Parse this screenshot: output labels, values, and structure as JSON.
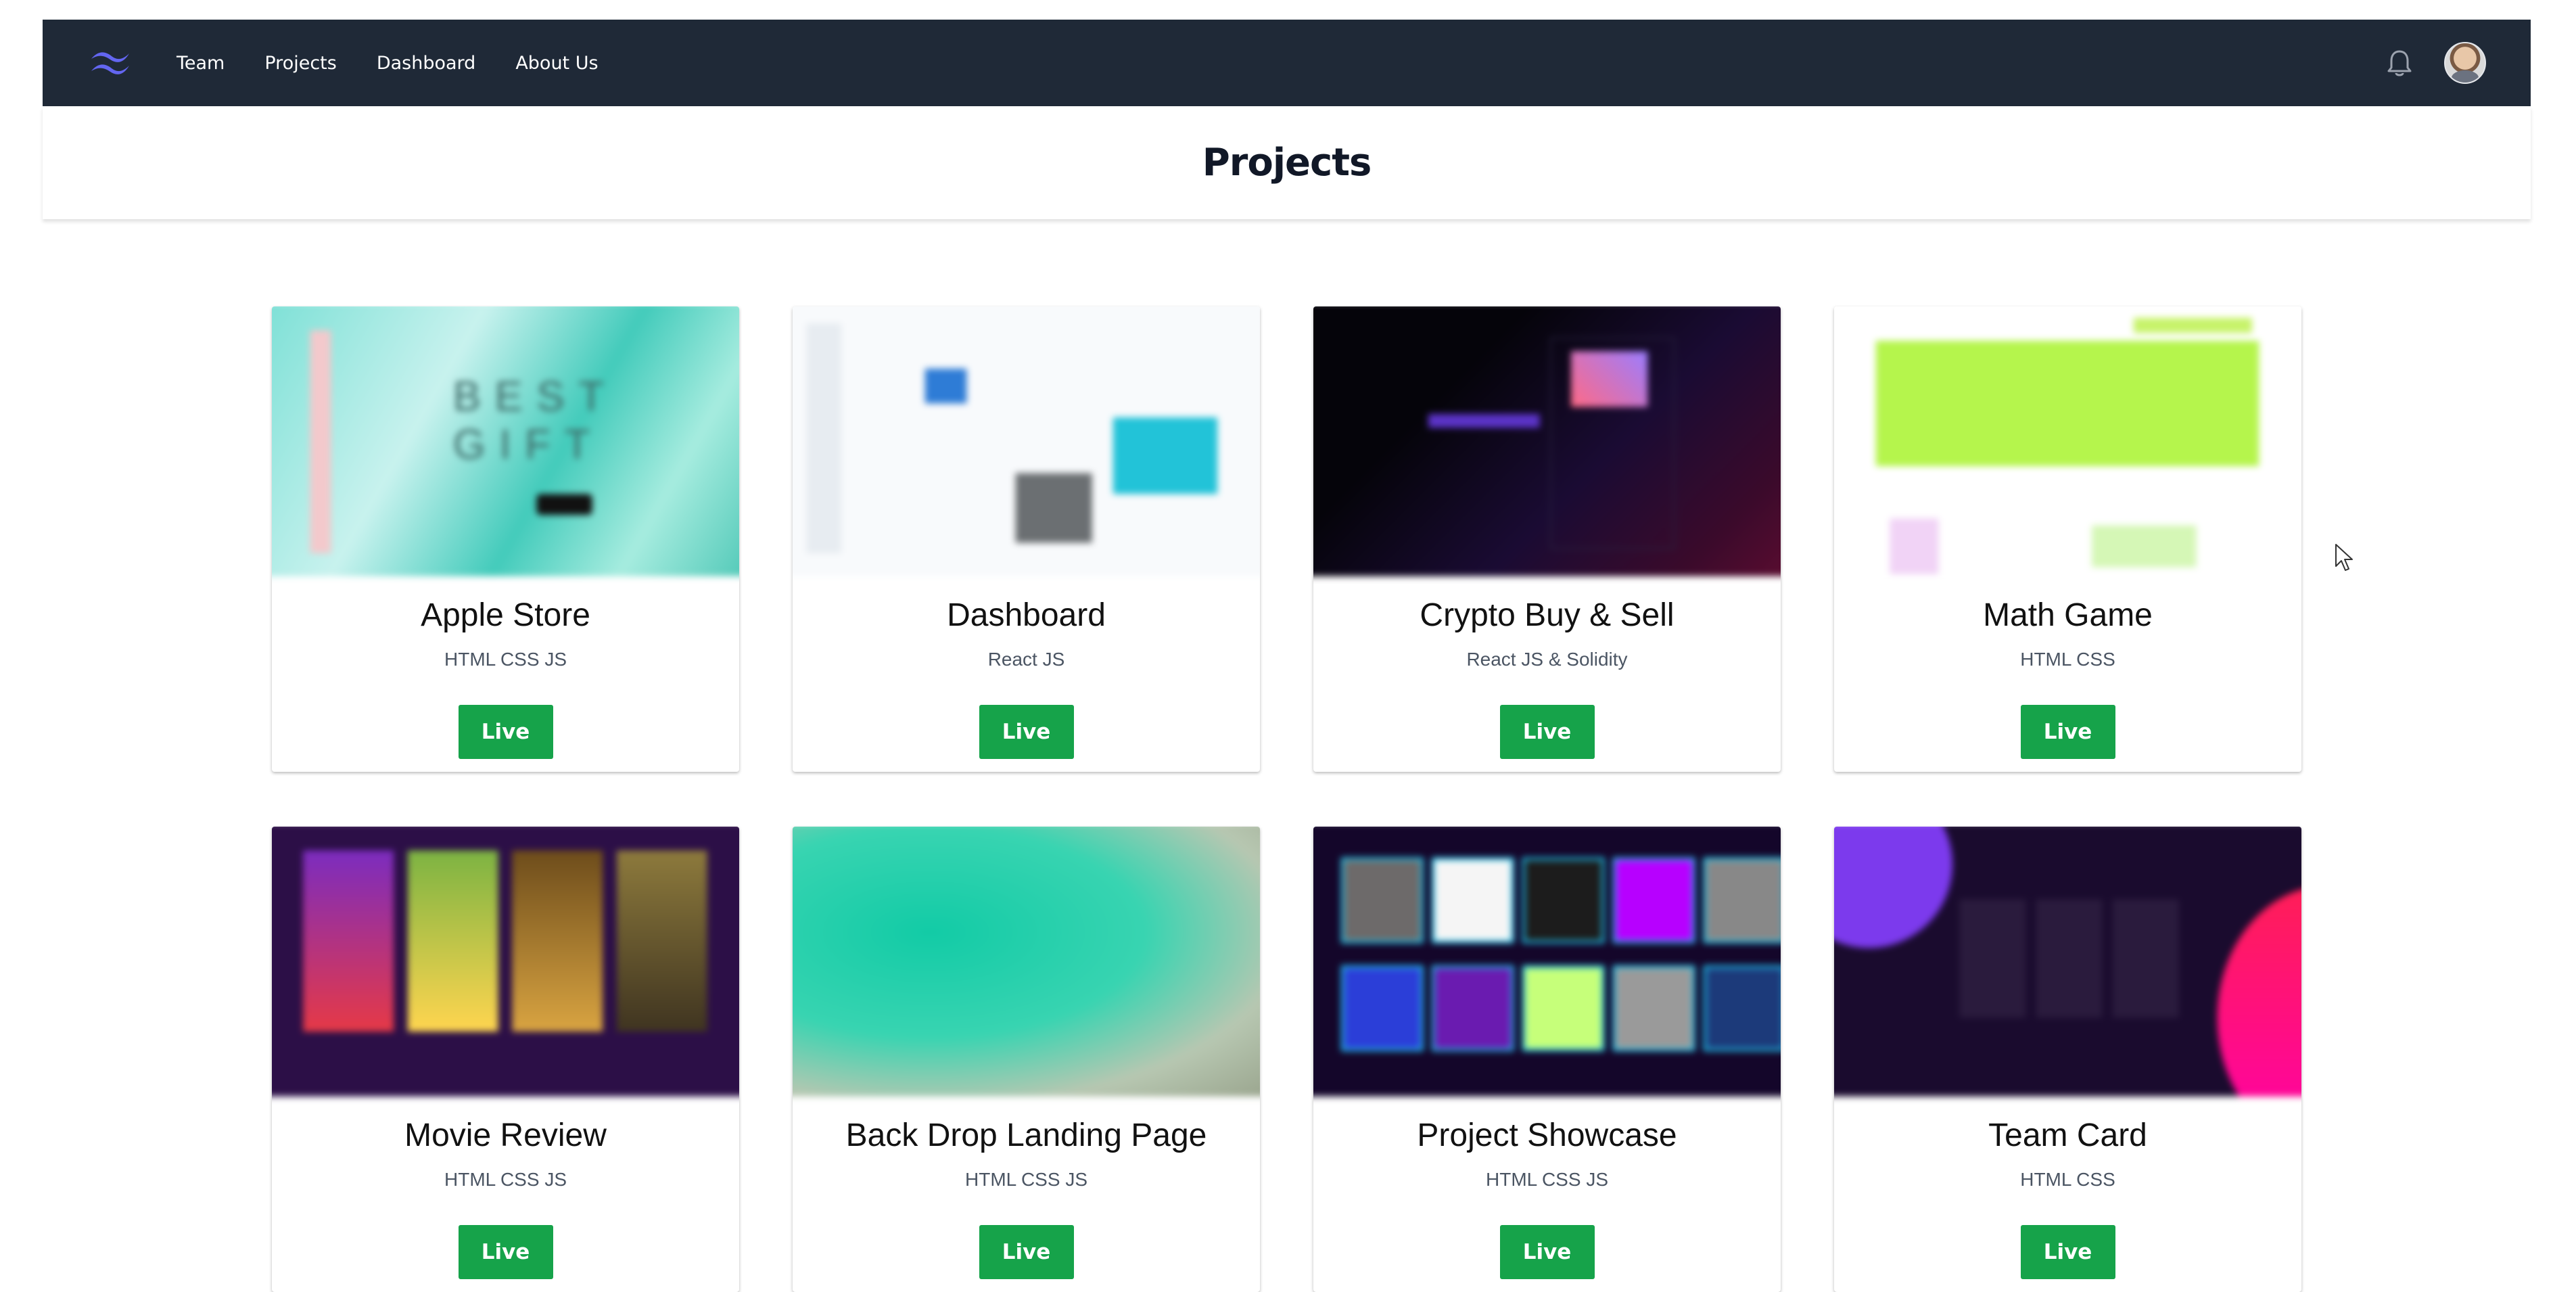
{
  "navbar": {
    "logo_icon": "tailwind-wave-logo-icon",
    "links": [
      {
        "label": "Team"
      },
      {
        "label": "Projects"
      },
      {
        "label": "Dashboard"
      },
      {
        "label": "About Us"
      }
    ],
    "bell_icon": "bell-icon",
    "avatar": "user-avatar"
  },
  "header": {
    "title": "Projects"
  },
  "projects": [
    {
      "title": "Apple Store",
      "tech": "HTML CSS JS",
      "button": "Live"
    },
    {
      "title": "Dashboard",
      "tech": "React JS",
      "button": "Live"
    },
    {
      "title": "Crypto Buy & Sell",
      "tech": "React JS & Solidity",
      "button": "Live"
    },
    {
      "title": "Math Game",
      "tech": "HTML CSS",
      "button": "Live"
    },
    {
      "title": "Movie Review",
      "tech": "HTML CSS JS",
      "button": "Live"
    },
    {
      "title": "Back Drop Landing Page",
      "tech": "HTML CSS JS",
      "button": "Live"
    },
    {
      "title": "Project Showcase",
      "tech": "HTML CSS JS",
      "button": "Live"
    },
    {
      "title": "Team Card",
      "tech": "HTML CSS",
      "button": "Live"
    }
  ],
  "colors": {
    "navbar_bg": "#1f2937",
    "live_button": "#16a34a",
    "logo_accent": "#6366f1"
  }
}
